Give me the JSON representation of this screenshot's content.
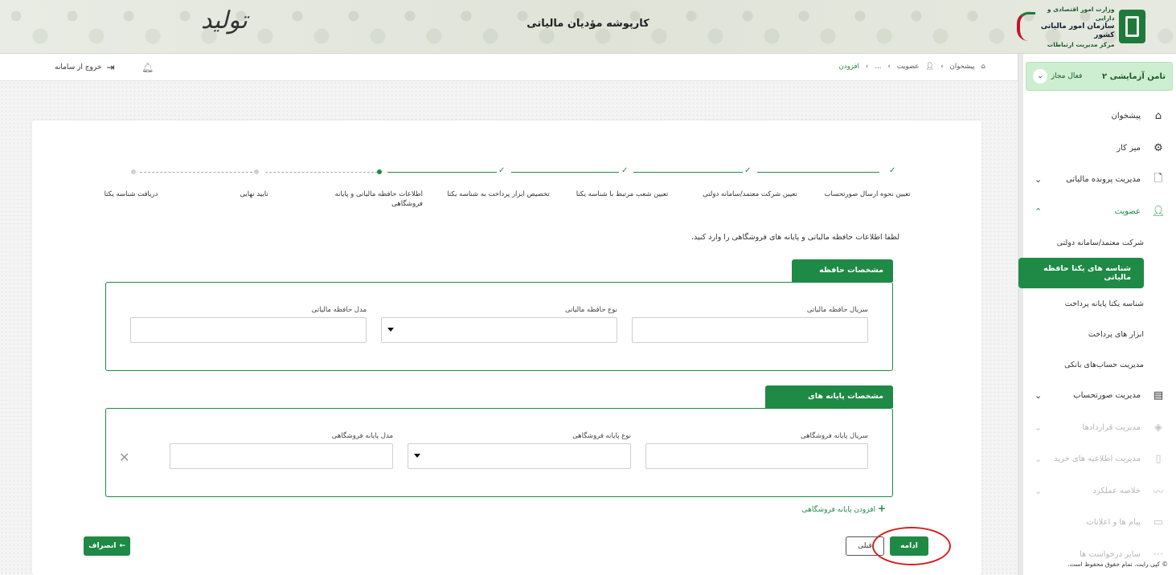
{
  "banner": {
    "title": "کارپوشه مؤدیان مالیاتی",
    "brand_line1": "وزارت امور اقتصادی و دارایی",
    "brand_line2": "سازمان امور مالیاتی کشور",
    "brand_line3": "مرکز مدیریت ارتباطات",
    "tolid": "تولید"
  },
  "sidebar": {
    "account_name": "تامن آزمایشی ۲",
    "account_role": "فعال مجاز",
    "items": [
      {
        "label": "پیشخوان",
        "icon": "home-icon"
      },
      {
        "label": "میز کار",
        "icon": "workspace-icon"
      },
      {
        "label": "مدیریت پرونده مالیاتی",
        "icon": "file-icon"
      },
      {
        "label": "عضویت",
        "icon": "user-icon"
      }
    ],
    "sub_items": [
      "شرکت معتمد/سامانه دولتی",
      "شناسه های یکتا حافظه مالیاتی",
      "شناسه یکتا پایانه پرداخت",
      "ابزار های پرداخت",
      "مدیریت حساب‌های بانکی"
    ],
    "items_after": [
      {
        "label": "مدیریت صورتحساب",
        "icon": "invoice-icon"
      },
      {
        "label": "مدیریت قراردادها",
        "icon": "handshake-icon"
      },
      {
        "label": "مدیریت اطلاعیه های خرید",
        "icon": "clipboard-icon"
      },
      {
        "label": "خلاصه عملکرد",
        "icon": "chart-icon"
      },
      {
        "label": "پیام ها و اعلانات",
        "icon": "message-icon"
      },
      {
        "label": "سایر درخواست ها",
        "icon": "more-icon"
      }
    ],
    "copyright": "© کپی رایت. تمام حقوق محفوظ است."
  },
  "topbar": {
    "crumbs": [
      "پیشخوان",
      "عضویت",
      "...",
      "افزودن"
    ],
    "exit_label": "خروج از سامانه"
  },
  "stepper": {
    "steps": [
      "تعیین نحوه ارسال صورتحساب",
      "تعیین شرکت معتمد/سامانه دولتی",
      "تعیین شعب مرتبط با شناسه یکتا",
      "تخصیص ابزار پرداخت به شناسه یکتا",
      "اطلاعات حافظه مالیاتی و پایانه فروشگاهی",
      "تایید نهایی",
      "دریافت شناسه یکتا"
    ]
  },
  "form": {
    "instruction": "لطفا اطلاعات حافظه مالیاتی و پایانه های فروشگاهی را وارد کنید.",
    "section1_title": "مشخصات حافظه مالیاتی",
    "s1_serial_label": "سریال حافظه مالیاتی",
    "s1_type_label": "نوع حافظه مالیاتی",
    "s1_model_label": "مدل حافظه مالیاتی",
    "section2_title": "مشخصات پایانه های فروشگاهی",
    "s2_serial_label": "سریال پایانه فروشگاهی",
    "s2_type_label": "نوع پایانه فروشگاهی",
    "s2_model_label": "مدل پایانه فروشگاهی",
    "add_terminal": "افزودن پایانه فروشگاهی"
  },
  "buttons": {
    "cancel": "انصراف",
    "prev": "قبلی",
    "next": "ادامه"
  },
  "colors": {
    "accent": "#1e8a45",
    "highlight_circle": "#d32020"
  }
}
